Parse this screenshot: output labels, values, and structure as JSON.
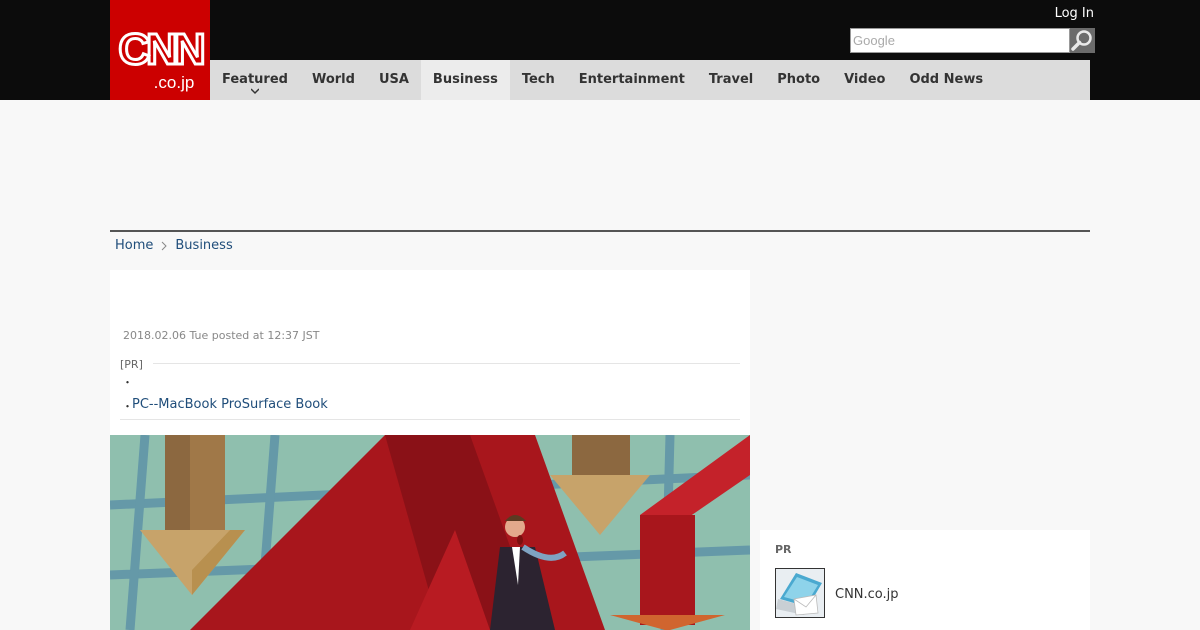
{
  "header": {
    "logo_text": "CNN.co.jp",
    "login_label": "Log In",
    "search_placeholder": "Google"
  },
  "nav": {
    "items": [
      {
        "label": "Featured"
      },
      {
        "label": "World"
      },
      {
        "label": "USA"
      },
      {
        "label": "Business"
      },
      {
        "label": "Tech"
      },
      {
        "label": "Entertainment"
      },
      {
        "label": "Travel"
      },
      {
        "label": "Photo"
      },
      {
        "label": "Video"
      },
      {
        "label": "Odd News"
      }
    ],
    "active": "Business"
  },
  "breadcrumb": {
    "home": "Home",
    "section": "Business"
  },
  "article": {
    "date": "2018.02.06 Tue posted at 12:37 JST",
    "pr_label": "[PR]",
    "bullet": "・",
    "pr_link": "PC--MacBook ProSurface Book"
  },
  "sidebar": {
    "pr_label": "PR",
    "pr_item": "CNN.co.jp"
  },
  "colors": {
    "brand_red": "#cc0000",
    "link_blue": "#1f4d7a",
    "header_black": "#0c0c0c",
    "nav_gray": "#dcdcdc"
  }
}
